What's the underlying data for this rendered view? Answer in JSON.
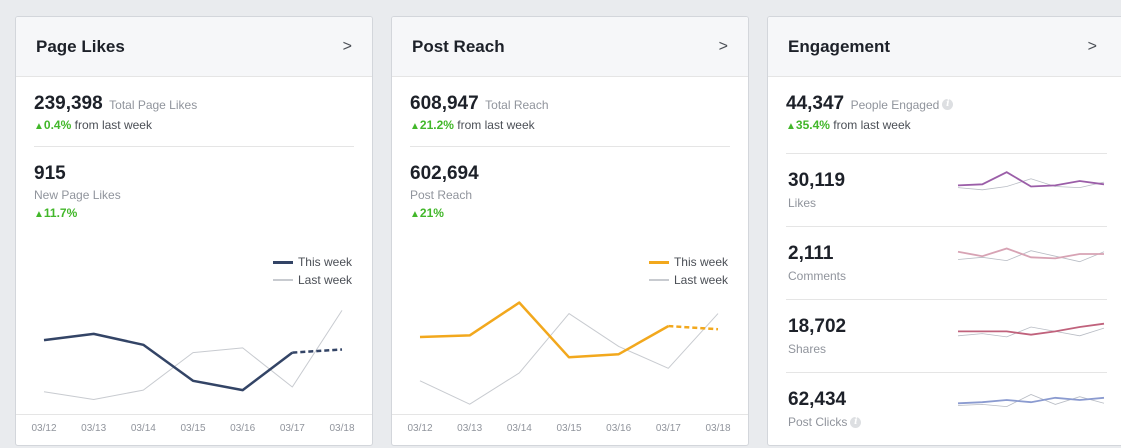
{
  "cards": {
    "likes": {
      "title": "Page Likes",
      "total_value": "239,398",
      "total_label": "Total Page Likes",
      "total_delta": "0.4%",
      "delta_suffix": "from last week",
      "metric_value": "915",
      "metric_label": "New Page Likes",
      "metric_delta": "11.7%",
      "legend_this": "This week",
      "legend_last": "Last week",
      "color_this": "#334466",
      "color_last": "#c8cbd0"
    },
    "reach": {
      "title": "Post Reach",
      "total_value": "608,947",
      "total_label": "Total Reach",
      "total_delta": "21.2%",
      "delta_suffix": "from last week",
      "metric_value": "602,694",
      "metric_label": "Post Reach",
      "metric_delta": "21%",
      "legend_this": "This week",
      "legend_last": "Last week",
      "color_this": "#f2a81d",
      "color_last": "#c8cbd0"
    },
    "engagement": {
      "title": "Engagement",
      "total_value": "44,347",
      "total_label": "People Engaged",
      "total_delta": "35.4%",
      "delta_suffix": "from last week",
      "rows": [
        {
          "value": "30,119",
          "label": "Likes",
          "color": "#9b5ea8"
        },
        {
          "value": "2,111",
          "label": "Comments",
          "color": "#d7a3b4"
        },
        {
          "value": "18,702",
          "label": "Shares",
          "color": "#c0627c"
        },
        {
          "value": "62,434",
          "label": "Post Clicks",
          "color": "#8b9bd0"
        }
      ]
    }
  },
  "icons": {
    "chevron": "chevron-right-icon",
    "info": "info-icon",
    "arrow_up": "arrow-up-icon"
  },
  "glyphs": {
    "chevron": ">",
    "arrow_up": "▲",
    "info": "i"
  },
  "chart_data": [
    {
      "type": "line",
      "categories": [
        "03/12",
        "03/13",
        "03/14",
        "03/15",
        "03/16",
        "03/17",
        "03/18"
      ],
      "series": [
        {
          "name": "This week",
          "values": [
            46,
            50,
            43,
            20,
            14,
            38,
            40
          ],
          "dashed_last_segment": true
        },
        {
          "name": "Last week",
          "values": [
            13,
            8,
            14,
            38,
            41,
            16,
            65
          ]
        }
      ]
    },
    {
      "type": "line",
      "categories": [
        "03/12",
        "03/13",
        "03/14",
        "03/15",
        "03/16",
        "03/17",
        "03/18"
      ],
      "series": [
        {
          "name": "This week",
          "values": [
            48,
            49,
            70,
            35,
            37,
            55,
            53
          ],
          "dashed_last_segment": true
        },
        {
          "name": "Last week",
          "values": [
            20,
            5,
            25,
            63,
            42,
            28,
            63
          ]
        }
      ]
    }
  ],
  "sparklines": {
    "likes": {
      "this": [
        6,
        7,
        18,
        5,
        6,
        10,
        7
      ],
      "last": [
        4,
        2,
        5,
        12,
        5,
        4,
        9
      ]
    },
    "comments": {
      "this": [
        12,
        8,
        15,
        7,
        6,
        10,
        10
      ],
      "last": [
        5,
        7,
        4,
        13,
        8,
        3,
        12
      ]
    },
    "shares": {
      "this": [
        6,
        6,
        6,
        3,
        6,
        10,
        13
      ],
      "last": [
        2,
        4,
        1,
        10,
        6,
        2,
        9
      ]
    },
    "clicks": {
      "this": [
        7,
        8,
        10,
        8,
        12,
        10,
        12
      ],
      "last": [
        5,
        6,
        4,
        15,
        6,
        13,
        7
      ]
    }
  }
}
